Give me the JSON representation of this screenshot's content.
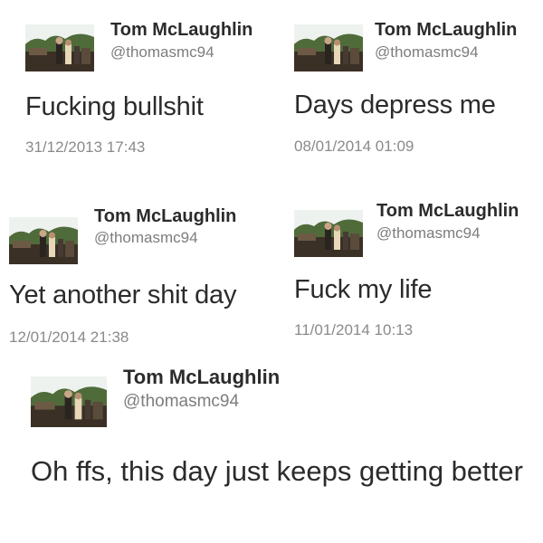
{
  "tweets": [
    {
      "name": "Tom McLaughlin",
      "handle": "@thomasmc94",
      "text": "Fucking bullshit",
      "timestamp": "31/12/2013 17:43"
    },
    {
      "name": "Tom McLaughlin",
      "handle": "@thomasmc94",
      "text": "Days depress me",
      "timestamp": "08/01/2014 01:09"
    },
    {
      "name": "Tom McLaughlin",
      "handle": "@thomasmc94",
      "text": "Yet another shit day",
      "timestamp": "12/01/2014 21:38"
    },
    {
      "name": "Tom McLaughlin",
      "handle": "@thomasmc94",
      "text": "Fuck my life",
      "timestamp": "11/01/2014 10:13"
    },
    {
      "name": "Tom McLaughlin",
      "handle": "@thomasmc94",
      "text": "Oh ffs, this day just keeps getting better"
    }
  ],
  "colors": {
    "name": "#2b2b2b",
    "handle": "#7d7d7d",
    "timestamp": "#8a8a8a",
    "background": "#ffffff"
  }
}
